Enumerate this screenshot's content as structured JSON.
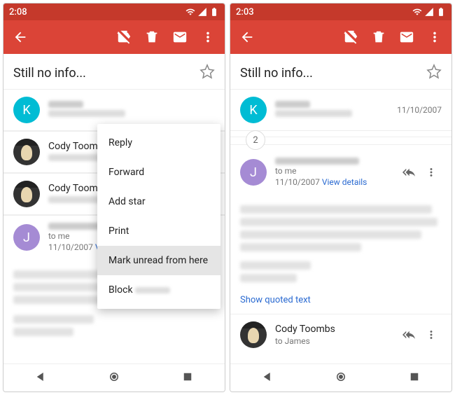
{
  "left": {
    "time": "2:08",
    "subject": "Still no info...",
    "senders": [
      {
        "initial": "K",
        "avatar": "k",
        "name_redacted": true,
        "sub_redacted": true
      },
      {
        "name": "Cody Toombs",
        "avatar": "img",
        "sub_redacted": true
      },
      {
        "name": "Cody Toombs",
        "avatar": "img",
        "sub_redacted": true
      }
    ],
    "expanded": {
      "initial": "J",
      "avatar": "j",
      "to": "to me",
      "date": "11/10/2007",
      "view_details": "View details"
    },
    "menu": {
      "reply": "Reply",
      "forward": "Forward",
      "add_star": "Add star",
      "print": "Print",
      "mark_unread": "Mark unread from here",
      "block": "Block"
    }
  },
  "right": {
    "time": "2:03",
    "subject": "Still no info...",
    "first_sender": {
      "initial": "K",
      "avatar": "k",
      "date": "11/10/2007"
    },
    "collapsed_count": "2",
    "expanded": {
      "initial": "J",
      "avatar": "j",
      "to": "to me",
      "date": "11/10/2007",
      "view_details": "View details"
    },
    "show_quoted": "Show quoted text",
    "last_sender": {
      "name": "Cody Toombs",
      "avatar": "img",
      "to": "to James"
    }
  }
}
